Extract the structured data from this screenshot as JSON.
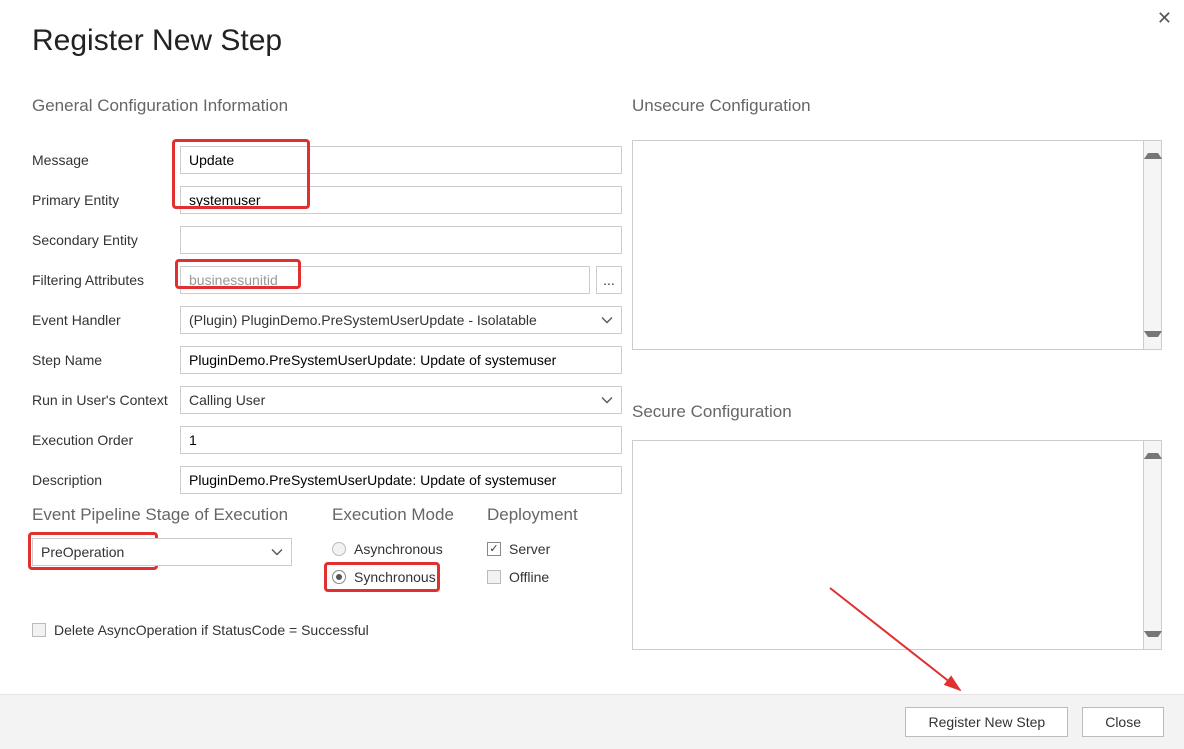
{
  "title": "Register New Step",
  "sections": {
    "general": "General Configuration Information",
    "unsecure": "Unsecure  Configuration",
    "secure": "Secure  Configuration",
    "pipeline": "Event Pipeline Stage of Execution",
    "exec_mode": "Execution Mode",
    "deployment": "Deployment"
  },
  "labels": {
    "message": "Message",
    "primary_entity": "Primary Entity",
    "secondary_entity": "Secondary Entity",
    "filtering_attributes": "Filtering Attributes",
    "event_handler": "Event Handler",
    "step_name": "Step Name",
    "run_context": "Run in User's Context",
    "execution_order": "Execution Order",
    "description": "Description",
    "delete_async": "Delete AsyncOperation if StatusCode = Successful"
  },
  "values": {
    "message": "Update",
    "primary_entity": "systemuser",
    "secondary_entity": "",
    "filtering_attributes": "businessunitid",
    "event_handler": "(Plugin) PluginDemo.PreSystemUserUpdate - Isolatable",
    "step_name": "PluginDemo.PreSystemUserUpdate: Update of systemuser",
    "run_context": "Calling User",
    "execution_order": "1",
    "description": "PluginDemo.PreSystemUserUpdate: Update of systemuser",
    "pipeline_stage": "PreOperation"
  },
  "exec_mode": {
    "async": "Asynchronous",
    "sync": "Synchronous",
    "selected": "sync"
  },
  "deployment": {
    "server": "Server",
    "offline": "Offline",
    "server_checked": true,
    "offline_checked": false
  },
  "buttons": {
    "register": "Register New Step",
    "close": "Close",
    "browse": "..."
  },
  "icons": {
    "close_x": "✕",
    "check": "✓"
  },
  "config_text": {
    "unsecure": "",
    "secure": ""
  }
}
